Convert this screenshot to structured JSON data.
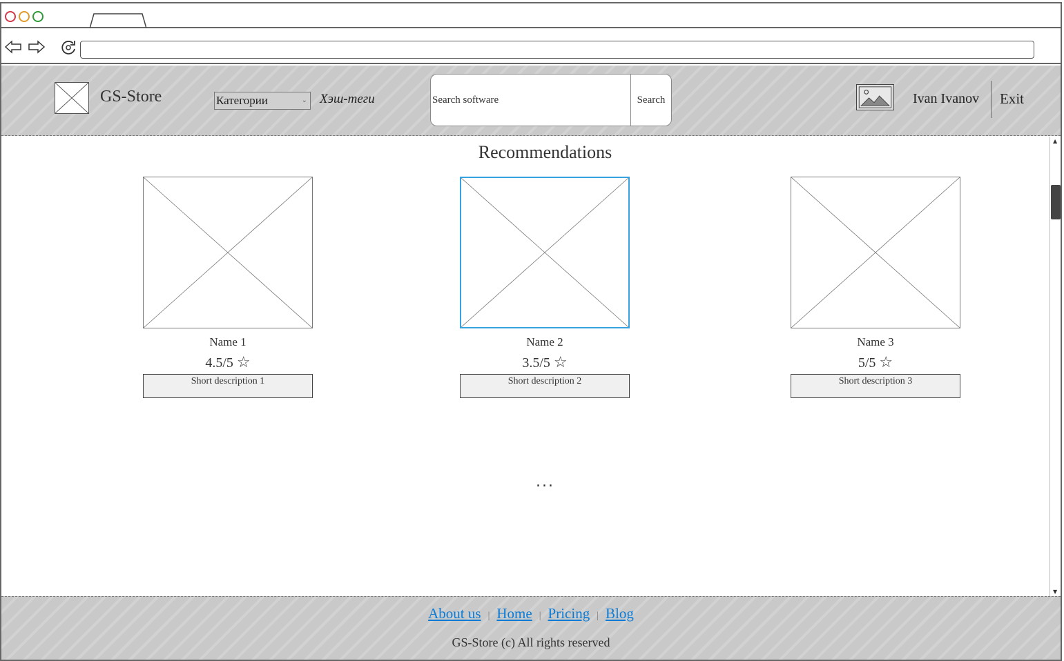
{
  "browser": {
    "url": ""
  },
  "header": {
    "site_name": "GS-Store",
    "category_selected": "Категории",
    "hashtags_label": "Хэш-теги",
    "search": {
      "placeholder": "Search software",
      "button_label": "Search"
    },
    "user_name": "Ivan Ivanov",
    "exit_label": "Exit"
  },
  "main": {
    "section_title": "Recommendations",
    "cards": [
      {
        "name": "Name 1",
        "rating": "4.5/5",
        "description": "Short description 1",
        "selected": false
      },
      {
        "name": "Name 2",
        "rating": "3.5/5",
        "description": "Short description 2",
        "selected": true
      },
      {
        "name": "Name 3",
        "rating": "5/5",
        "description": "Short description 3",
        "selected": false
      }
    ],
    "more_indicator": "..."
  },
  "footer": {
    "links": [
      "About us",
      "Home",
      "Pricing",
      "Blog"
    ],
    "copyright": "GS-Store (c) All rights reserved"
  },
  "colors": {
    "selected_border": "#36a3e0",
    "link": "#0a7bd6",
    "header_bg": "#c9c9c9"
  }
}
